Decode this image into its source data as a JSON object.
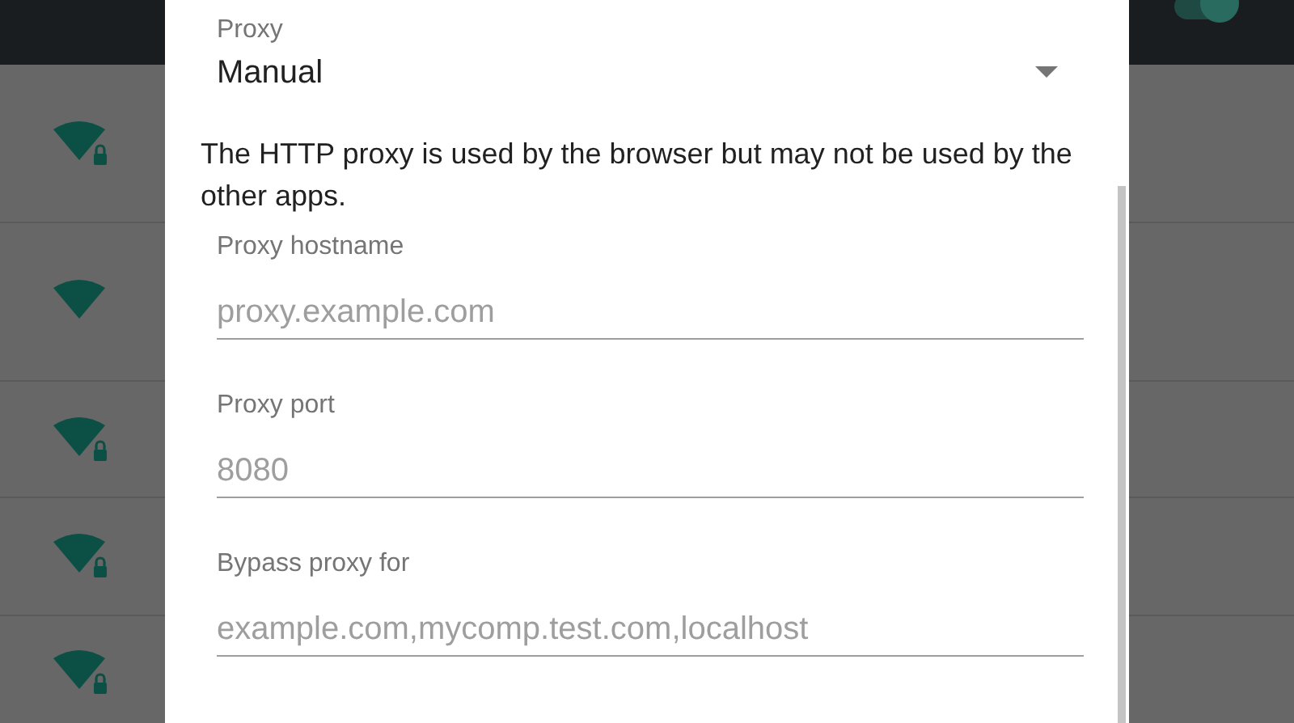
{
  "wifi_switch": {
    "on": true
  },
  "networks": [
    {
      "locked": true
    },
    {
      "locked": false
    },
    {
      "locked": true
    },
    {
      "locked": true
    },
    {
      "locked": true
    }
  ],
  "dialog": {
    "proxy": {
      "label": "Proxy",
      "value": "Manual"
    },
    "note": "The HTTP proxy is used by the browser but may not be used by the other apps.",
    "fields": [
      {
        "label": "Proxy hostname",
        "placeholder": "proxy.example.com"
      },
      {
        "label": "Proxy port",
        "placeholder": "8080"
      },
      {
        "label": "Bypass proxy for",
        "placeholder": "example.com,mycomp.test.com,localhost"
      }
    ]
  }
}
